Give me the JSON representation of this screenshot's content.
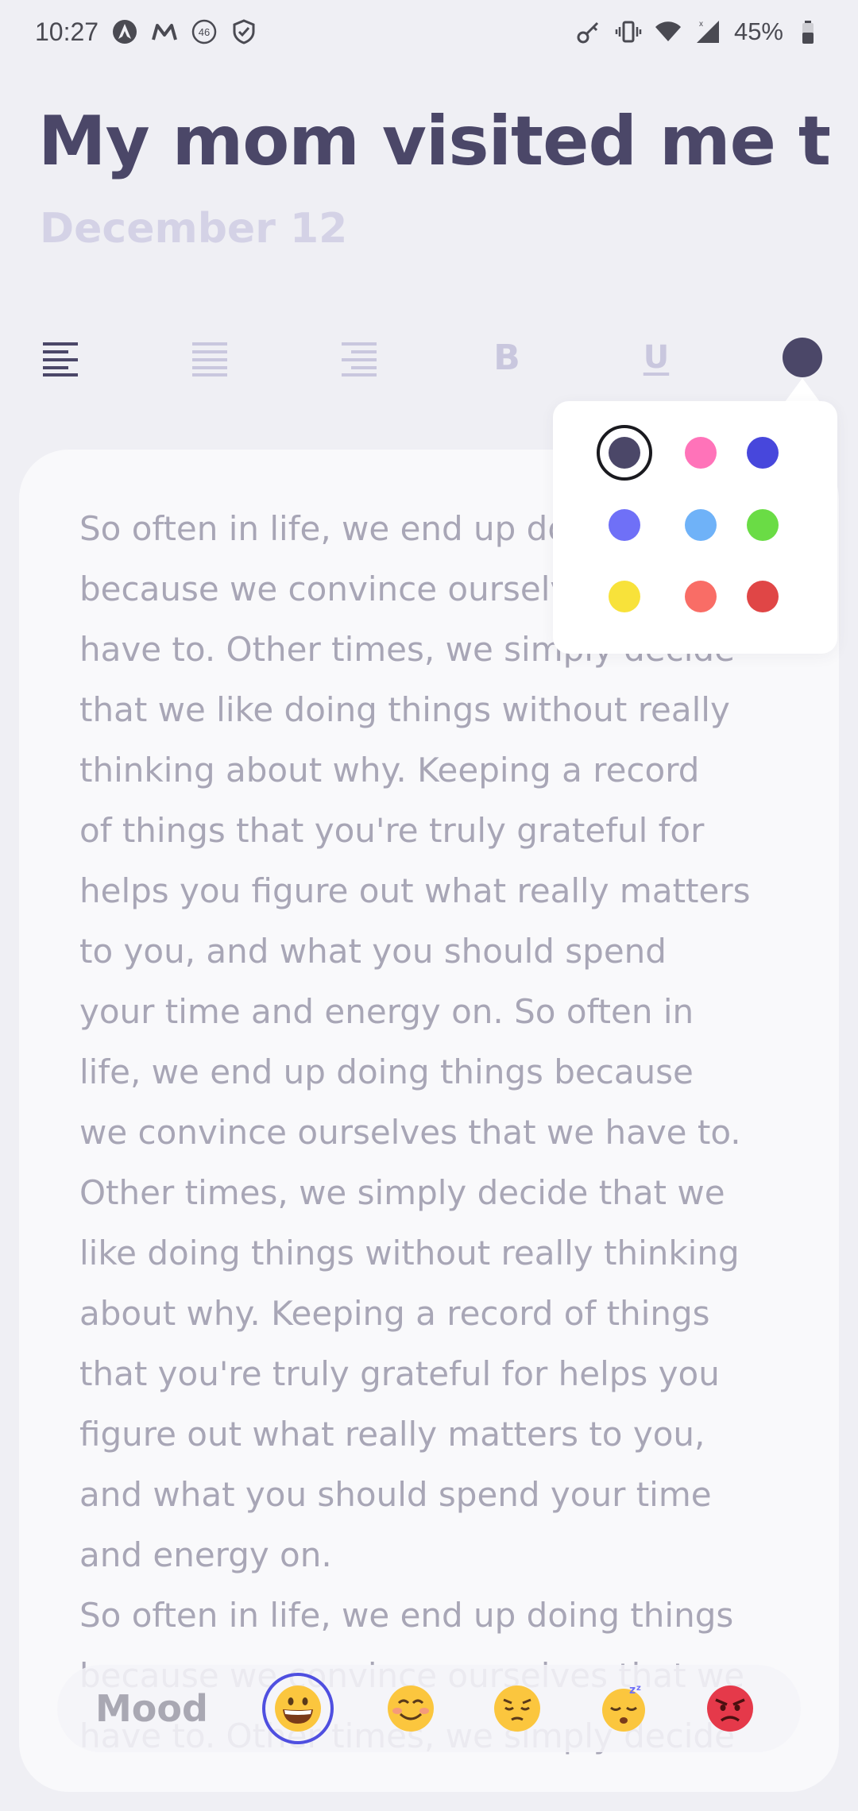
{
  "status_bar": {
    "time": "10:27",
    "battery_percent": "45%",
    "left_icons": [
      "arch-linux-icon",
      "mail-m-icon",
      "data-46-icon",
      "shield-icon"
    ],
    "right_icons": [
      "key-icon",
      "vibrate-icon",
      "wifi-icon",
      "signal-icon",
      "battery-icon"
    ]
  },
  "entry": {
    "title": "My mom visited me t..",
    "date": "December 12",
    "body": "So often in life, we end up doing things\nbecause we convince ourselves that we\nhave to. Other times, we simply decide\nthat we like doing things without really\nthinking about why. Keeping a record\nof things that you're truly grateful for\nhelps you figure out what really matters\nto you, and what you should spend\nyour time and energy on. So often in\nlife, we end up doing things because\nwe convince ourselves that we have to.\nOther times, we simply decide that we\nlike doing things without really thinking\nabout why. Keeping a record of things\nthat you're truly grateful for helps you\nfigure out what really matters to you,\nand what you should spend your time\nand energy on.\nSo often in life, we end up doing things\nbecause we convince ourselves that we\nhave to. Other times, we simply decide"
  },
  "toolbar": {
    "bold_label": "B",
    "underline_label": "U",
    "align_left_color": "#4b4768",
    "inactive_color": "#c9c7de",
    "current_text_color": "#4b4768"
  },
  "color_picker": {
    "selected": "#4b4768",
    "swatches": [
      [
        "#4b4768",
        "#ff73b9",
        "#4747dc"
      ],
      [
        "#6f70f7",
        "#6fb2f8",
        "#6adc45"
      ],
      [
        "#f8e23a",
        "#f96d66",
        "#e04646"
      ]
    ]
  },
  "mood": {
    "label": "Mood",
    "selected_index": 0,
    "options": [
      "grinning-face-icon",
      "smiling-face-icon",
      "pensive-face-icon",
      "sleeping-face-icon",
      "angry-face-icon"
    ]
  }
}
